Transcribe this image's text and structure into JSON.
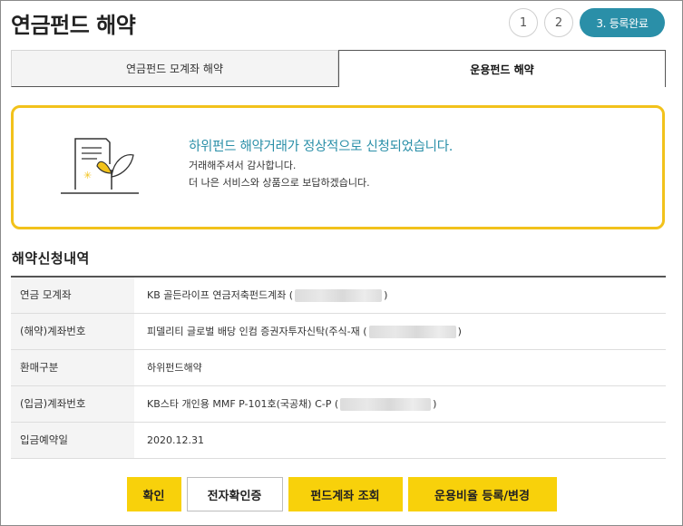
{
  "page": {
    "title": "연금펀드 해약"
  },
  "steps": {
    "step1": "1",
    "step2": "2",
    "step3": "3. 등록완료"
  },
  "tabs": [
    {
      "label": "연금펀드 모계좌 해약",
      "active": false
    },
    {
      "label": "운용펀드 해약",
      "active": true
    }
  ],
  "notice": {
    "headline": "하위펀드 해약거래가 정상적으로 신청되었습니다.",
    "line1": "거래해주셔서 감사합니다.",
    "line2": "더 나은 서비스와 상품으로 보답하겠습니다.",
    "icon": "document-plant-icon"
  },
  "section": {
    "title": "해약신청내역"
  },
  "table": {
    "rows": [
      {
        "label": "연금 모계좌",
        "value_prefix": "KB 골든라이프 연금저축펀드계좌 (",
        "value_suffix": ")",
        "masked": true
      },
      {
        "label": "(해약)계좌번호",
        "value_prefix": "피델리티 글로벌 배당 인컴 증권자투자신탁(주식-재 (",
        "value_suffix": ")",
        "masked": true
      },
      {
        "label": "환매구분",
        "value_prefix": "하위펀드해약",
        "value_suffix": "",
        "masked": false
      },
      {
        "label": "(입금)계좌번호",
        "value_prefix": "KB스타 개인용 MMF P-101호(국공채) C-P (",
        "value_suffix": ")",
        "masked": true
      },
      {
        "label": "입금예약일",
        "value_prefix": "2020.12.31",
        "value_suffix": "",
        "masked": false
      }
    ]
  },
  "buttons": {
    "confirm": "확인",
    "e_cert": "전자확인증",
    "fund_lookup": "펀드계좌 조회",
    "ratio_register": "운용비율 등록/변경"
  },
  "colors": {
    "accent_teal": "#2a8fa8",
    "accent_yellow": "#f8d10b",
    "notice_border": "#f2c21b"
  }
}
